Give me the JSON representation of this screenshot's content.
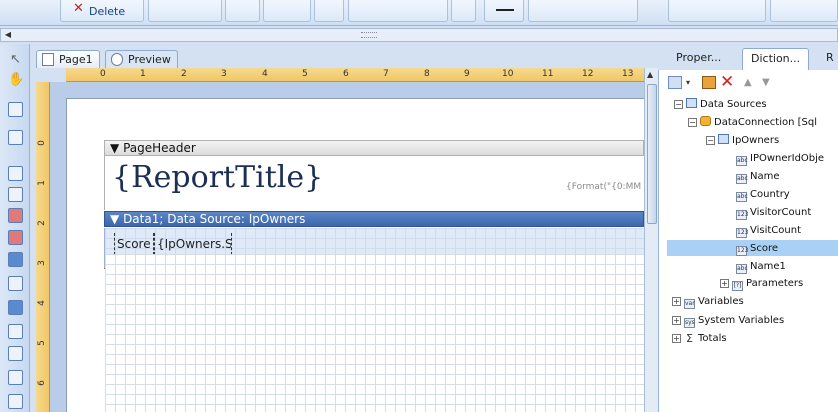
{
  "toolbar": {
    "delete_label": "Delete"
  },
  "tabs": [
    {
      "label": "Page1"
    },
    {
      "label": "Preview"
    }
  ],
  "ruler": {
    "horizontal": [
      "0",
      "1",
      "2",
      "3",
      "4",
      "5",
      "6",
      "7",
      "8",
      "9",
      "10",
      "11",
      "12",
      "13"
    ],
    "vertical": [
      "0",
      "1",
      "2",
      "3",
      "4",
      "5",
      "6"
    ]
  },
  "report": {
    "page_header_label": "PageHeader",
    "title_text": "{ReportTitle}",
    "format_text": "{Format(\"{0:MM",
    "data_band_label": "Data1; Data Source: IpOwners",
    "cells": [
      "Score",
      "{IpOwners.Sc"
    ]
  },
  "right_panel": {
    "tabs": [
      "Proper...",
      "Diction...",
      "R"
    ],
    "tree": [
      {
        "label": "Data Sources"
      },
      {
        "label": "DataConnection [Sql"
      },
      {
        "label": "IpOwners"
      },
      {
        "label": "IPOwnerIdObje"
      },
      {
        "label": "Name"
      },
      {
        "label": "Country"
      },
      {
        "label": "VisitorCount"
      },
      {
        "label": "VisitCount"
      },
      {
        "label": "Score"
      },
      {
        "label": "Name1"
      },
      {
        "label": "Parameters"
      },
      {
        "label": "Variables"
      },
      {
        "label": "System Variables"
      },
      {
        "label": "Totals"
      }
    ]
  },
  "colors": {
    "accent": "#3b67ad",
    "selection": "#a9d1f6",
    "ruler": "#f0c765"
  }
}
